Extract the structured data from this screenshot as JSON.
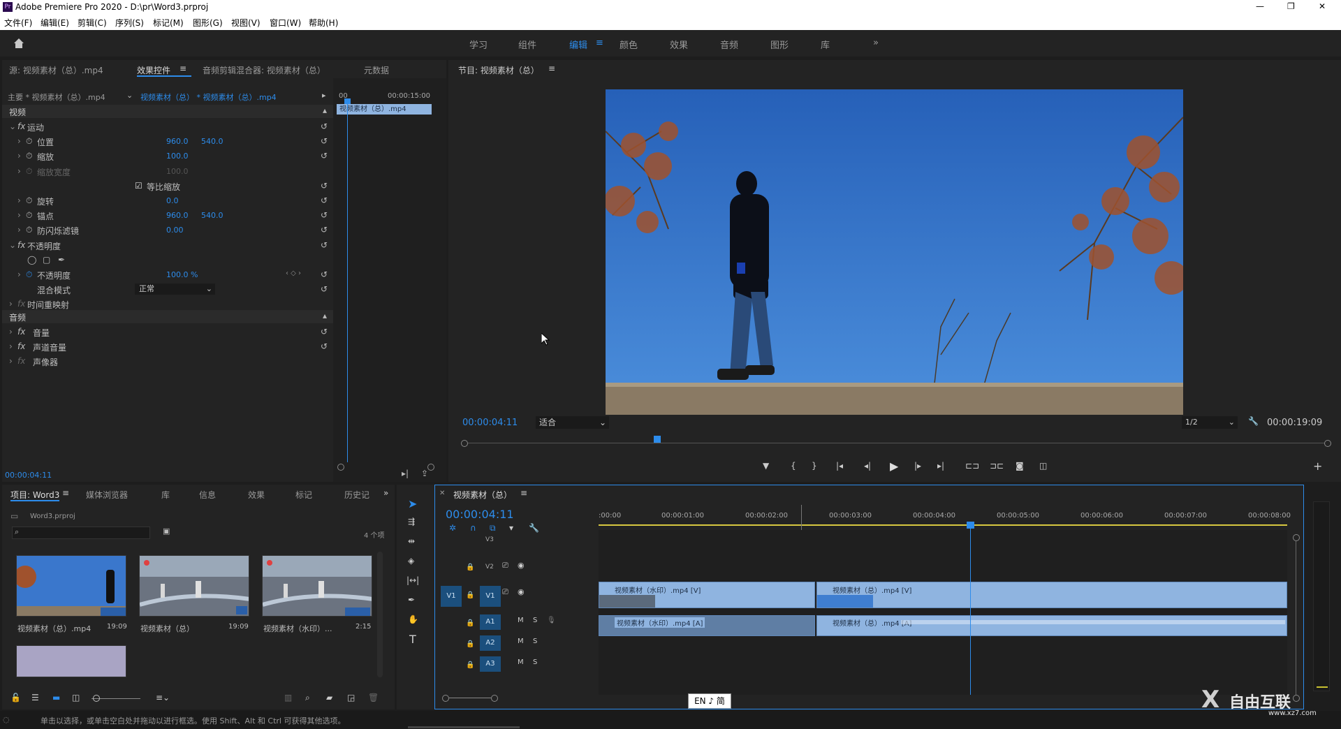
{
  "app": {
    "title": "Adobe Premiere Pro 2020 - D:\\pr\\Word3.prproj"
  },
  "window_controls": {
    "minimize": "—",
    "maximize": "❐",
    "close": "✕"
  },
  "menu": [
    "文件(F)",
    "编辑(E)",
    "剪辑(C)",
    "序列(S)",
    "标记(M)",
    "图形(G)",
    "视图(V)",
    "窗口(W)",
    "帮助(H)"
  ],
  "workspaces": [
    "学习",
    "组件",
    "编辑",
    "颜色",
    "效果",
    "音频",
    "图形",
    "库"
  ],
  "workspace_more": "»",
  "source_panel": {
    "tabs": [
      "源: 视频素材（总）.mp4",
      "效果控件",
      "音频剪辑混合器: 视频素材（总）",
      "元数据"
    ],
    "master": "主要 * 视频素材（总）.mp4",
    "seq_clip": "视频素材（总） * 视频素材（总）.mp4",
    "tc_start": "00",
    "tc_end": "00:00:15:00",
    "clip_label": "视频素材（总）.mp4",
    "video_section": "视频",
    "audio_section": "音频",
    "rows": [
      {
        "name": "运动",
        "fx": true
      },
      {
        "name": "位置",
        "v1": "960.0",
        "v2": "540.0"
      },
      {
        "name": "缩放",
        "v1": "100.0"
      },
      {
        "name": "缩放宽度",
        "v1": "100.0",
        "dim": true
      },
      {
        "name": "等比缩放",
        "checkbox": true
      },
      {
        "name": "旋转",
        "v1": "0.0"
      },
      {
        "name": "锚点",
        "v1": "960.0",
        "v2": "540.0"
      },
      {
        "name": "防闪烁滤镜",
        "v1": "0.00"
      },
      {
        "name": "不透明度",
        "fx": true
      },
      {
        "name": "shapes"
      },
      {
        "name": "不透明度",
        "v1": "100.0 %"
      },
      {
        "name": "混合模式",
        "select": "正常"
      },
      {
        "name": "时间重映射",
        "fx": true,
        "dim": true
      }
    ],
    "audio_rows": [
      "音量",
      "声道音量",
      "声像器"
    ],
    "timecode": "00:00:04:11"
  },
  "program_panel": {
    "title": "节目: 视频素材（总）",
    "timecode": "00:00:04:11",
    "fit": "适合",
    "resolution": "1/2",
    "duration": "00:00:19:09",
    "playhead": 0.34
  },
  "project_panel": {
    "tabs": [
      "项目: Word3",
      "媒体浏览器",
      "库",
      "信息",
      "效果",
      "标记",
      "历史记"
    ],
    "file": "Word3.prproj",
    "count": "4 个项",
    "items": [
      {
        "name": "视频素材（总）.mp4",
        "dur": "19:09"
      },
      {
        "name": "视频素材（总）",
        "dur": "19:09"
      },
      {
        "name": "视频素材（水印）...",
        "dur": "2:15"
      }
    ]
  },
  "timeline": {
    "title": "视频素材（总）",
    "timecode": "00:00:04:11",
    "ruler": [
      ":00:00",
      "00:00:01:00",
      "00:00:02:00",
      "00:00:03:00",
      "00:00:04:00",
      "00:00:05:00",
      "00:00:06:00",
      "00:00:07:00",
      "00:00:08:00"
    ],
    "tracks": [
      "V3",
      "V2",
      "V1",
      "A1",
      "A2",
      "A3"
    ],
    "clips": {
      "v1a": "视频素材（水印）.mp4 [V]",
      "v1b": "视频素材（总）.mp4 [V]",
      "a1a": "视频素材（水印）.mp4 [A]",
      "a1b": "视频素材（总）.mp4 [A]"
    },
    "track_btn_m": "M",
    "track_btn_s": "S"
  },
  "status": {
    "text": "单击以选择，或单击空白处并拖动以进行框选。使用 Shift、Alt 和 Ctrl 可获得其他选项。"
  },
  "ime": {
    "text": "EN ♪ 简"
  },
  "watermark": {
    "text": "自由互联",
    "url": "www.xz7.com"
  }
}
